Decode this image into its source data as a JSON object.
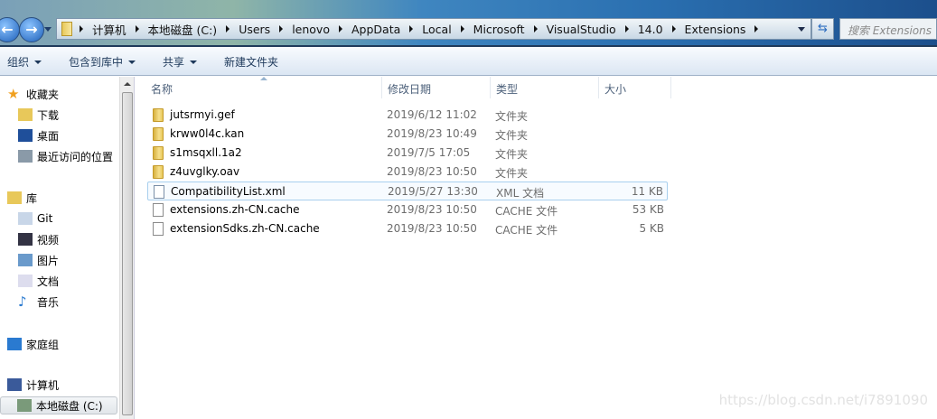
{
  "address": {
    "crumbs": [
      "计算机",
      "本地磁盘 (C:)",
      "Users",
      "lenovo",
      "AppData",
      "Local",
      "Microsoft",
      "VisualStudio",
      "14.0",
      "Extensions"
    ]
  },
  "search": {
    "placeholder": "搜索 Extensions"
  },
  "toolbar": {
    "organize": "组织",
    "include": "包含到库中",
    "share": "共享",
    "new_folder": "新建文件夹"
  },
  "sidebar": {
    "items": [
      "收藏夹",
      "下载",
      "桌面",
      "最近访问的位置",
      "库",
      "Git",
      "视频",
      "图片",
      "文档",
      "音乐",
      "家庭组",
      "计算机",
      "本地磁盘 (C:)"
    ]
  },
  "columns": {
    "name": "名称",
    "date": "修改日期",
    "type": "类型",
    "size": "大小"
  },
  "files": [
    {
      "name": "jutsrmyi.gef",
      "date": "2019/6/12 11:02",
      "type": "文件夹",
      "size": ""
    },
    {
      "name": "krww0l4c.kan",
      "date": "2019/8/23 10:49",
      "type": "文件夹",
      "size": ""
    },
    {
      "name": "s1msqxll.1a2",
      "date": "2019/7/5 17:05",
      "type": "文件夹",
      "size": ""
    },
    {
      "name": "z4uvglky.oav",
      "date": "2019/8/23 10:50",
      "type": "文件夹",
      "size": ""
    },
    {
      "name": "CompatibilityList.xml",
      "date": "2019/5/27 13:30",
      "type": "XML 文档",
      "size": "11 KB"
    },
    {
      "name": "extensions.zh-CN.cache",
      "date": "2019/8/23 10:50",
      "type": "CACHE 文件",
      "size": "53 KB"
    },
    {
      "name": "extensionSdks.zh-CN.cache",
      "date": "2019/8/23 10:50",
      "type": "CACHE 文件",
      "size": "5 KB"
    }
  ],
  "watermark": "https://blog.csdn.net/i7891090"
}
